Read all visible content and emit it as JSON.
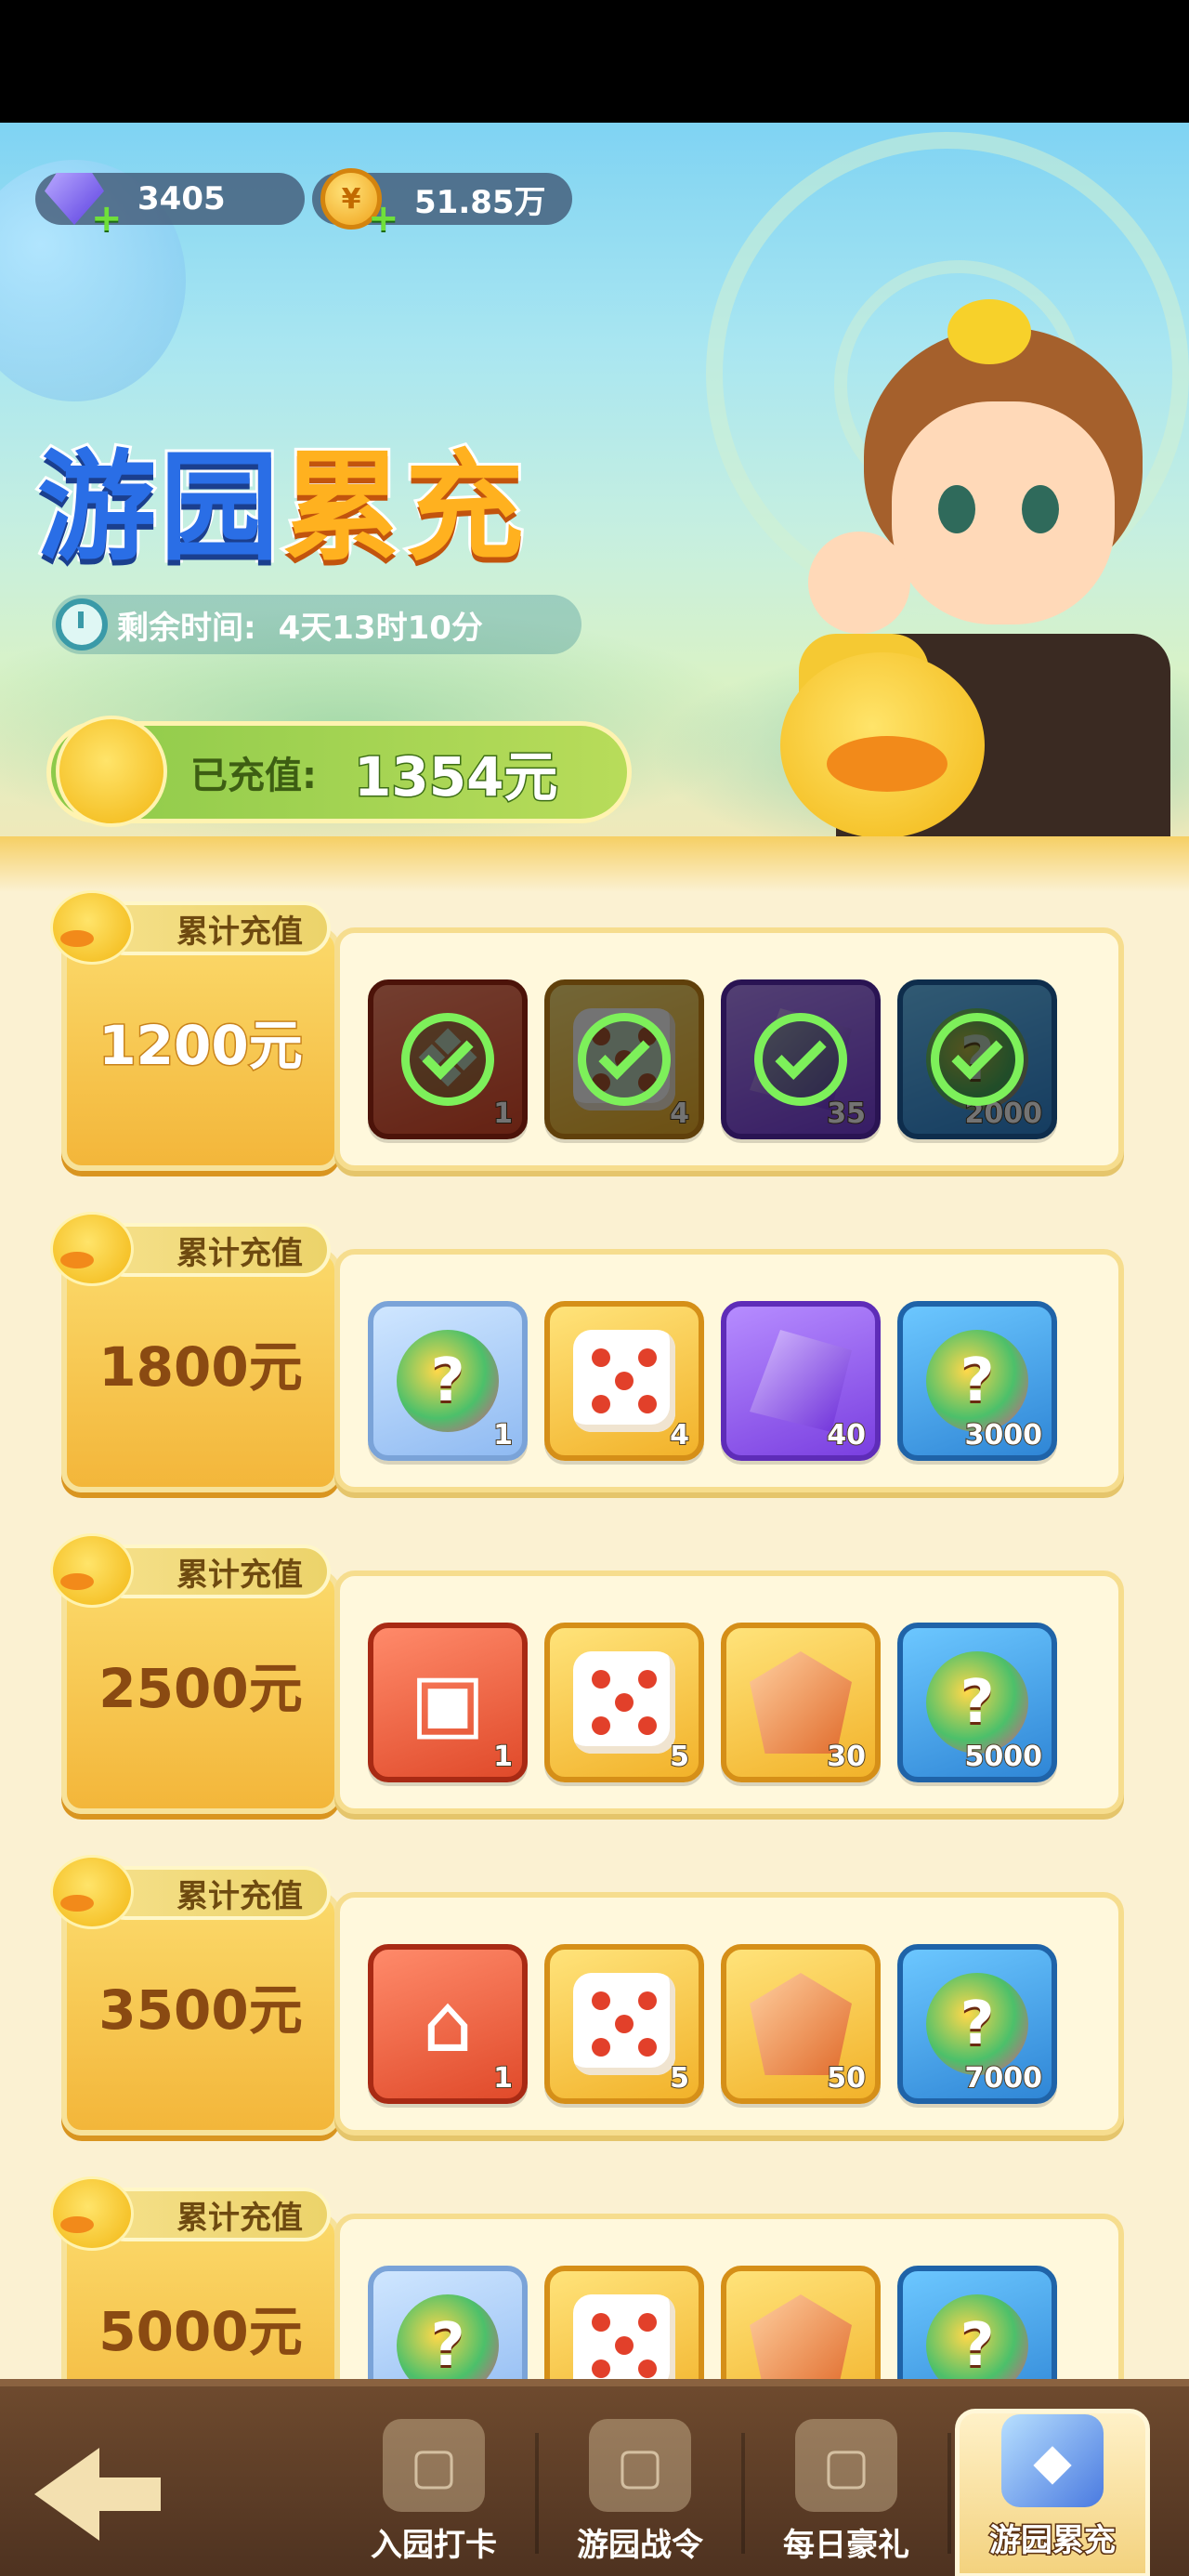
{
  "currencies": {
    "gems": {
      "icon": "gem-icon",
      "value": "3405"
    },
    "coins": {
      "icon": "coin-icon",
      "value": "51.85万"
    }
  },
  "event": {
    "title_part1": "游园",
    "title_part2": "累充",
    "time_label": "剩余时间:",
    "time_value": "4天13时10分",
    "paid_label": "已充值:",
    "paid_value": "1354元"
  },
  "tier_tag": "累计充值",
  "tiers": [
    {
      "amount": "1200元",
      "claimed": true,
      "rewards": [
        {
          "icon": "mystery-gift-icon",
          "qty": "1",
          "bg": "red"
        },
        {
          "icon": "dice-icon",
          "qty": "4",
          "bg": "gold"
        },
        {
          "icon": "amethyst-icon",
          "qty": "35",
          "bg": "purple"
        },
        {
          "icon": "mystery-ball-icon",
          "qty": "2000",
          "bg": "teal"
        }
      ]
    },
    {
      "amount": "1800元",
      "claimed": false,
      "rewards": [
        {
          "icon": "crystal-pack-icon",
          "qty": "1",
          "bg": "blue"
        },
        {
          "icon": "dice-icon",
          "qty": "4",
          "bg": "gold"
        },
        {
          "icon": "amethyst-icon",
          "qty": "40",
          "bg": "purple"
        },
        {
          "icon": "mystery-ball-icon",
          "qty": "3000",
          "bg": "teal"
        }
      ]
    },
    {
      "amount": "2500元",
      "claimed": false,
      "rewards": [
        {
          "icon": "treasure-box-icon",
          "qty": "1",
          "bg": "red"
        },
        {
          "icon": "dice-icon",
          "qty": "5",
          "bg": "gold"
        },
        {
          "icon": "fire-crystal-icon",
          "qty": "30",
          "bg": "gold"
        },
        {
          "icon": "mystery-ball-icon",
          "qty": "5000",
          "bg": "teal"
        }
      ]
    },
    {
      "amount": "3500元",
      "claimed": false,
      "rewards": [
        {
          "icon": "duck-castle-icon",
          "qty": "1",
          "bg": "red"
        },
        {
          "icon": "dice-icon",
          "qty": "5",
          "bg": "gold"
        },
        {
          "icon": "fire-crystal-icon",
          "qty": "50",
          "bg": "gold"
        },
        {
          "icon": "mystery-ball-icon",
          "qty": "7000",
          "bg": "teal"
        }
      ]
    },
    {
      "amount": "5000元",
      "claimed": false,
      "rewards": [
        {
          "icon": "mystery-gate-icon",
          "qty": "",
          "bg": "blue"
        },
        {
          "icon": "dice-icon",
          "qty": "",
          "bg": "gold"
        },
        {
          "icon": "fire-crystal-icon",
          "qty": "",
          "bg": "gold"
        },
        {
          "icon": "mystery-ball-icon",
          "qty": "",
          "bg": "teal"
        }
      ]
    }
  ],
  "nav": {
    "back_icon": "back-arrow-icon",
    "tabs": [
      {
        "label": "入园打卡",
        "icon": "checkin-icon",
        "active": false
      },
      {
        "label": "游园战令",
        "icon": "battle-pass-icon",
        "active": false
      },
      {
        "label": "每日豪礼",
        "icon": "daily-gift-icon",
        "active": false
      },
      {
        "label": "游园累充",
        "icon": "recharge-gem-icon",
        "active": true
      }
    ]
  }
}
